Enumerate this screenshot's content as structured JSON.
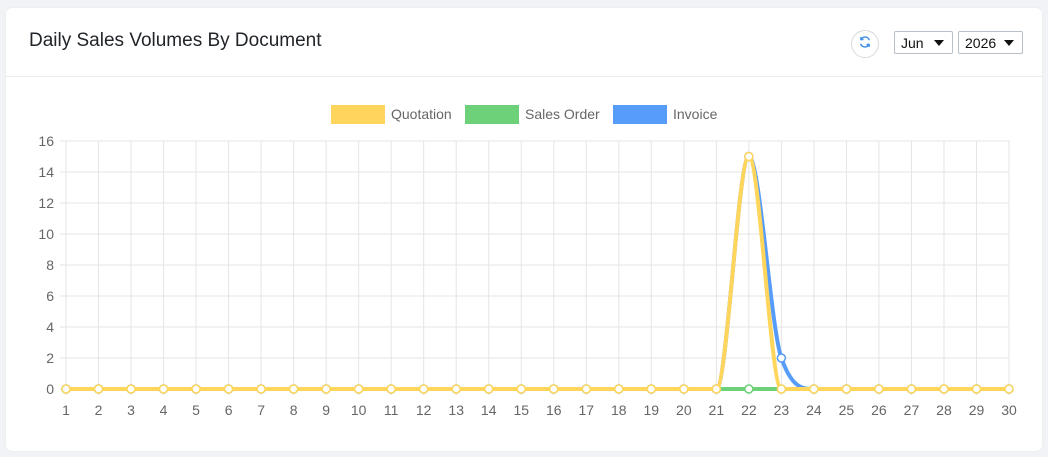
{
  "header": {
    "title": "Daily Sales Volumes By Document",
    "refresh_icon": "refresh-icon",
    "month": "Jun",
    "year": "2026"
  },
  "colors": {
    "quotation": "#ffd55c",
    "sales_order": "#6dd17a",
    "invoice": "#569cf8",
    "grid": "#e5e5e5",
    "axis_text": "#666666"
  },
  "chart_data": {
    "type": "line",
    "x": [
      1,
      2,
      3,
      4,
      5,
      6,
      7,
      8,
      9,
      10,
      11,
      12,
      13,
      14,
      15,
      16,
      17,
      18,
      19,
      20,
      21,
      22,
      23,
      24,
      25,
      26,
      27,
      28,
      29,
      30
    ],
    "ylim": [
      0,
      16
    ],
    "yticks": [
      0,
      2,
      4,
      6,
      8,
      10,
      12,
      14,
      16
    ],
    "grid": true,
    "legend": "top",
    "series": [
      {
        "name": "Quotation",
        "color": "#ffd55c",
        "values": [
          0,
          0,
          0,
          0,
          0,
          0,
          0,
          0,
          0,
          0,
          0,
          0,
          0,
          0,
          0,
          0,
          0,
          0,
          0,
          0,
          0,
          15,
          0,
          0,
          0,
          0,
          0,
          0,
          0,
          0
        ]
      },
      {
        "name": "Sales Order",
        "color": "#6dd17a",
        "values": [
          0,
          0,
          0,
          0,
          0,
          0,
          0,
          0,
          0,
          0,
          0,
          0,
          0,
          0,
          0,
          0,
          0,
          0,
          0,
          0,
          0,
          0,
          0,
          0,
          0,
          0,
          0,
          0,
          0,
          0
        ]
      },
      {
        "name": "Invoice",
        "color": "#569cf8",
        "values": [
          0,
          0,
          0,
          0,
          0,
          0,
          0,
          0,
          0,
          0,
          0,
          0,
          0,
          0,
          0,
          0,
          0,
          0,
          0,
          0,
          0,
          15,
          2,
          0,
          0,
          0,
          0,
          0,
          0,
          0
        ]
      }
    ]
  }
}
